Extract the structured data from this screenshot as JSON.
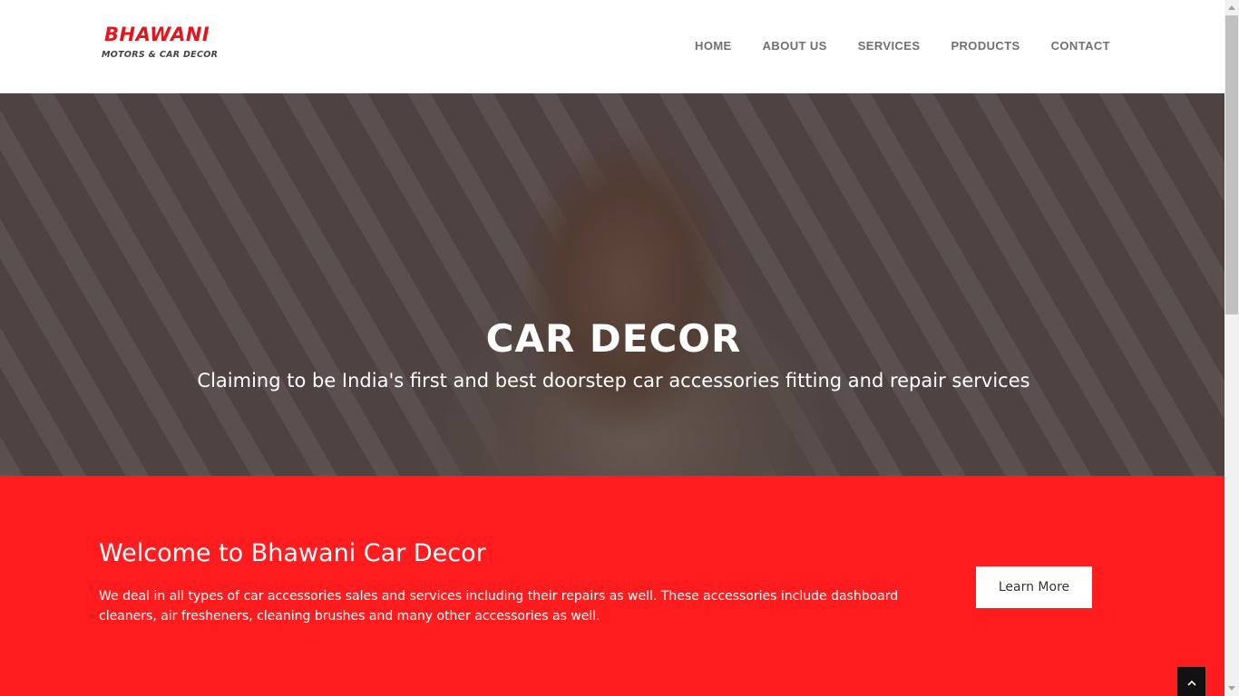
{
  "brand": {
    "name": "BHAWANI",
    "tagline": "MOTORS & CAR DECOR",
    "color": "#e3161e"
  },
  "nav": {
    "items": [
      "HOME",
      "ABOUT US",
      "SERVICES",
      "PRODUCTS",
      "CONTACT"
    ]
  },
  "hero": {
    "title": "CAR DECOR",
    "subtitle": "Claiming to be India's first and best doorstep car accessories fitting and repair services"
  },
  "welcome": {
    "title": "Welcome to Bhawani Car Decor",
    "text": "We deal in all types of car accessories sales and services including their repairs as well. These accessories include dashboard cleaners, air fresheners, cleaning brushes and many other accessories as well.",
    "button_label": "Learn More",
    "background": "#ff1c1e"
  },
  "icons": {
    "scroll_top": "chevron-up-icon"
  }
}
